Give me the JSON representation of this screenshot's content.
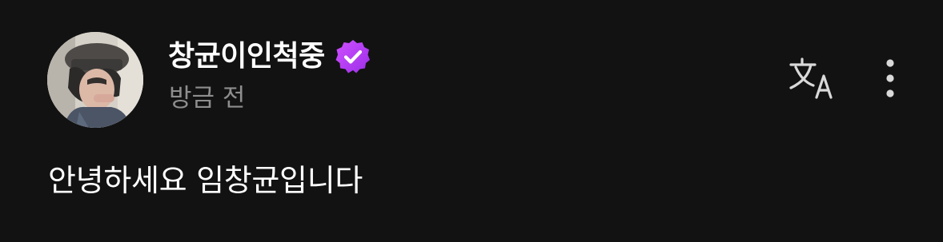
{
  "post": {
    "author": {
      "username": "창균이인척중",
      "verified": true,
      "verified_badge_color": "#b43cf0"
    },
    "timestamp": "방금 전",
    "text": "안녕하세요 임창균입니다",
    "actions": {
      "translate_icon": "translate-icon",
      "more_icon": "more-vertical-icon"
    }
  },
  "colors": {
    "background": "#121212",
    "primary_text": "#ffffff",
    "secondary_text": "#8e8e8e",
    "icon": "#d9d9d9"
  }
}
